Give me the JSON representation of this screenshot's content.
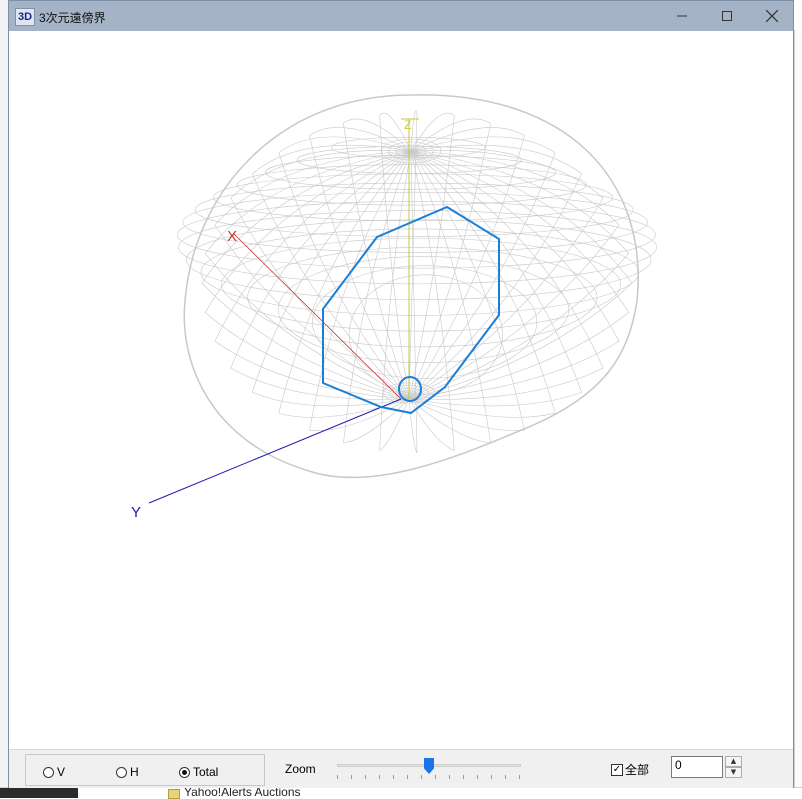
{
  "window": {
    "icon_text": "3D",
    "title": "3次元遠傍界",
    "minimize_icon": "minimize-icon",
    "maximize_icon": "maximize-icon",
    "close_icon": "close-icon"
  },
  "plot": {
    "x_axis_label": "X",
    "y_axis_label": "Y",
    "z_axis_label": "Z",
    "colors": {
      "mesh": "#c8c8c8",
      "x_axis": "#c83030",
      "y_axis": "#1a1ab0",
      "z_axis": "#c8c840",
      "contour": "#1a7fd8"
    }
  },
  "controls": {
    "radio_options": [
      {
        "label": "V",
        "selected": false
      },
      {
        "label": "H",
        "selected": false
      },
      {
        "label": "Total",
        "selected": true
      }
    ],
    "zoom_label": "Zoom",
    "zoom_level": 0.5,
    "all_checkbox_label": "全部",
    "all_checked": true,
    "spin_value": "0"
  },
  "background": {
    "tree_item_text": "Yahoo!Alerts Auctions"
  }
}
